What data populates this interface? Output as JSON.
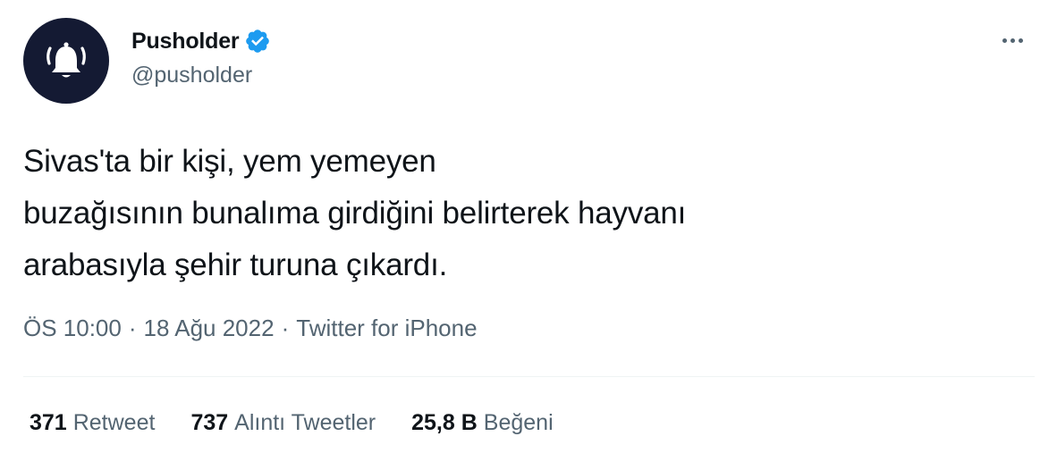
{
  "user": {
    "display_name": "Pusholder",
    "handle": "@pusholder",
    "verified_icon": "verified-badge-icon",
    "avatar_icon": "bell-icon",
    "avatar_bg": "#141a33",
    "verified_color": "#1d9bf0"
  },
  "menu": {
    "icon": "more-horizontal-icon"
  },
  "tweet": {
    "lines": [
      "Sivas'ta bir kişi, yem yemeyen",
      "buzağısının bunalıma girdiğini belirterek hayvanı",
      "arabasıyla şehir turuna çıkardı."
    ]
  },
  "meta": {
    "time": "ÖS 10:00",
    "separator": "·",
    "date": "18 Ağu 2022",
    "source": "Twitter for iPhone"
  },
  "stats": [
    {
      "count": "371",
      "label": "Retweet"
    },
    {
      "count": "737",
      "label": "Alıntı Tweetler"
    },
    {
      "count": "25,8 B",
      "label": "Beğeni"
    }
  ],
  "colors": {
    "text_primary": "#0f1419",
    "text_secondary": "#536471",
    "divider": "#eff3f4"
  }
}
